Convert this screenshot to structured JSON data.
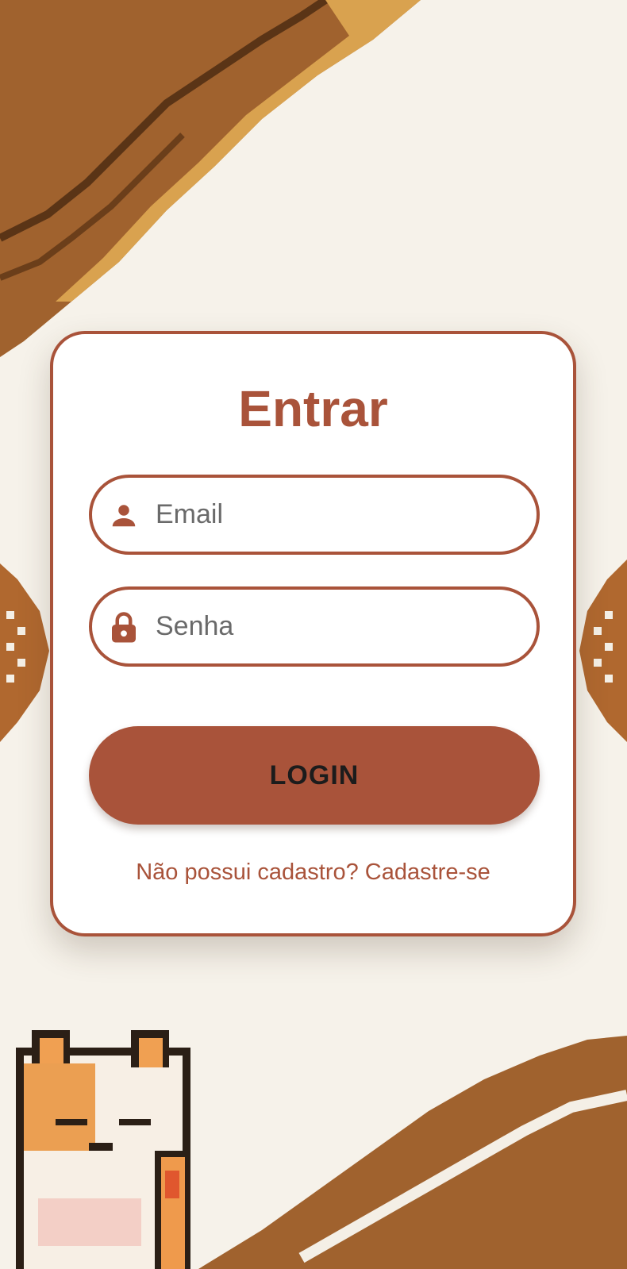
{
  "login": {
    "title": "Entrar",
    "email_placeholder": "Email",
    "password_placeholder": "Senha",
    "login_button": "LOGIN",
    "signup_link": "Não possui cadastro? Cadastre-se"
  },
  "icons": {
    "email": "person-icon",
    "password": "lock-icon"
  },
  "colors": {
    "accent": "#a9533a",
    "background": "#f6f2ea",
    "card": "#ffffff",
    "button_text": "#1c1c1c"
  }
}
